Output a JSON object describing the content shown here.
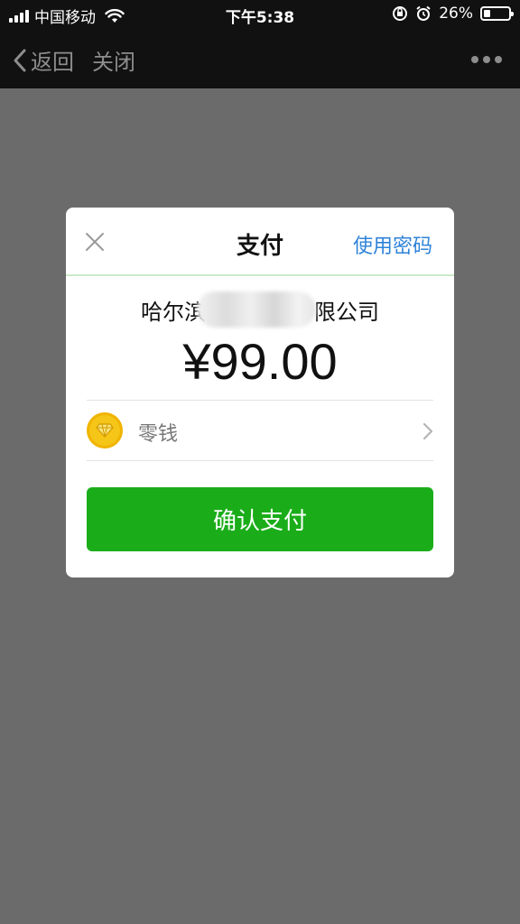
{
  "status_bar": {
    "carrier": "中国移动",
    "time": "下午5:38",
    "battery_text": "26%",
    "battery_level": 0.26,
    "icons": [
      "signal-icon",
      "wifi-icon",
      "rotation-lock-icon",
      "alarm-icon",
      "battery-icon"
    ]
  },
  "nav": {
    "back_label": "返回",
    "close_label": "关闭",
    "icons": [
      "chevron-left-icon",
      "more-icon"
    ]
  },
  "dialog": {
    "title": "支付",
    "use_password_label": "使用密码",
    "merchant_name_prefix": "哈尔滨",
    "merchant_name_suffix": "限公司",
    "amount": "¥99.00",
    "payment_method": {
      "label": "零钱",
      "icon": "wallet-coin-icon"
    },
    "confirm_label": "确认支付"
  },
  "colors": {
    "confirm_button": "#1aad19",
    "link_blue": "#2f83d8",
    "coin_yellow": "#f5c518",
    "overlay_gray": "#6b6b6b",
    "bar_dark": "#111111"
  }
}
